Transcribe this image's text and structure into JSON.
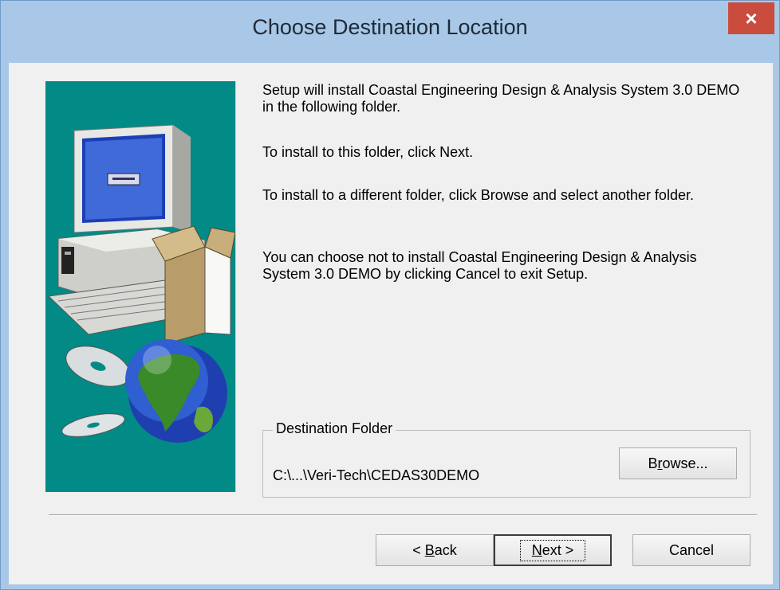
{
  "window": {
    "title": "Choose Destination Location",
    "close_label": "×"
  },
  "messages": [
    "Setup will install Coastal Engineering Design & Analysis System 3.0 DEMO in the following folder.",
    "To install to this folder, click Next.",
    "To install to a different folder, click Browse and select another folder.",
    "You can choose not to install Coastal Engineering Design & Analysis System 3.0 DEMO by clicking Cancel to exit Setup."
  ],
  "destination": {
    "legend": "Destination Folder",
    "path": "C:\\...\\Veri-Tech\\CEDAS30DEMO",
    "browse_pre": "B",
    "browse_mnemonic": "r",
    "browse_post": "owse..."
  },
  "buttons": {
    "back_pre": "< ",
    "back_mnemonic": "B",
    "back_post": "ack",
    "next_mnemonic": "N",
    "next_post": "ext >",
    "cancel": "Cancel"
  },
  "colors": {
    "titlebar": "#a9c8e8",
    "close": "#c94c3c",
    "panel": "#028a86"
  },
  "icons": [
    "computer-illustration",
    "cd-discs-illustration",
    "globe-illustration",
    "close-icon"
  ]
}
